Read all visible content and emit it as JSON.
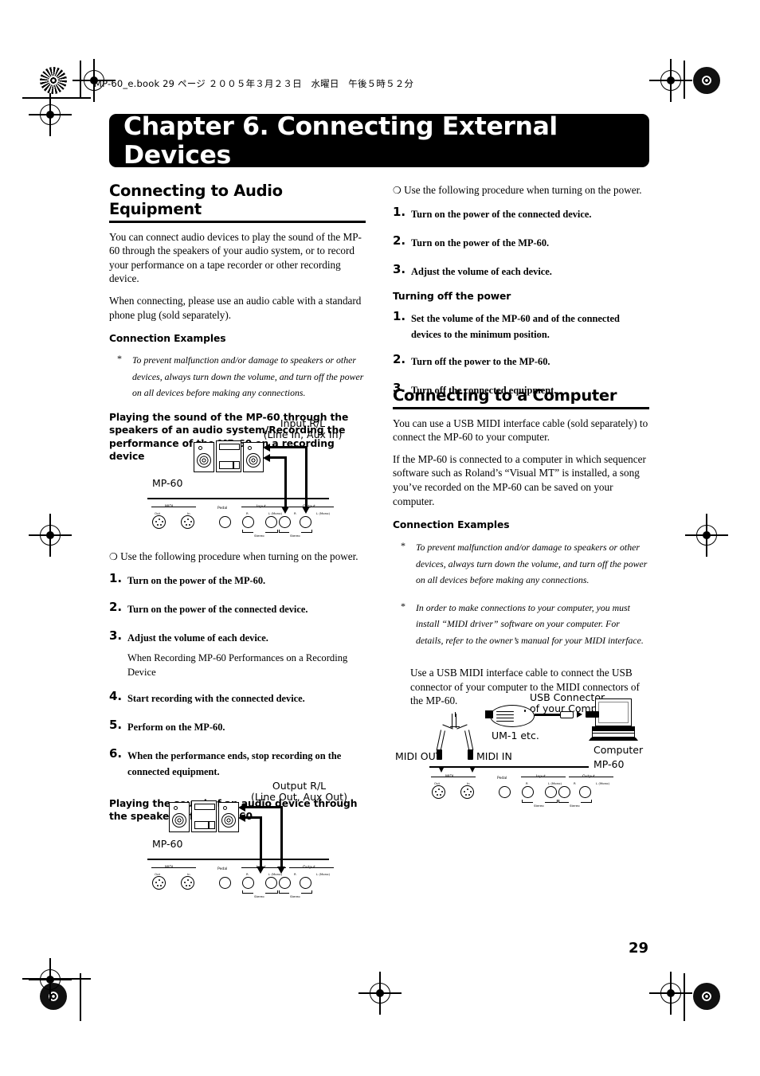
{
  "page": {
    "header_line": "MP-60_e.book  29 ページ  ２００５年３月２３日　水曜日　午後５時５２分",
    "chapter_title": "Chapter 6. Connecting External Devices",
    "page_number": "29"
  },
  "left_column": {
    "section_title": "Connecting to Audio Equipment",
    "paragraphs": [
      "You can connect audio devices to play the sound of the MP-60 through the speakers of your audio system, or to record your performance on a tape recorder or other recording device.",
      "When connecting, please use an audio cable with a standard phone plug (sold separately)."
    ],
    "connection_examples_heading": "Connection Examples",
    "note_star": "*",
    "note_text": "To prevent malfunction and/or damage to speakers or other devices, always turn down the volume, and turn off the power on all devices before making any connections.",
    "subheading_1": "Playing the sound of the MP-60 through the speakers of an audio system/Recording the performance of the MP-60 on a recording device",
    "power_on_line": "Use the following procedure when turning on the power.",
    "steps": [
      {
        "num": "1.",
        "text": "Turn on the power of the MP-60."
      },
      {
        "num": "2.",
        "text": "Turn on the power of the connected device."
      },
      {
        "num": "3.",
        "text": "Adjust the volume of each device.",
        "sub": "When Recording MP-60 Performances on a Recording Device"
      },
      {
        "num": "4.",
        "text": "Start recording with the connected device."
      },
      {
        "num": "5.",
        "text": "Perform on the MP-60."
      },
      {
        "num": "6.",
        "text": "When the performance ends, stop recording on the connected equipment."
      }
    ],
    "subheading_2": "Playing the sound of an audio device through the speakers of the MP-60"
  },
  "right_column": {
    "power_on_line": "Use the following procedure when turning on the power.",
    "power_on_steps": [
      {
        "num": "1.",
        "text": "Turn on the power of the connected device."
      },
      {
        "num": "2.",
        "text": "Turn on the power of the MP-60."
      },
      {
        "num": "3.",
        "text": "Adjust the volume of each device."
      }
    ],
    "power_off_heading": "Turning off the power",
    "power_off_steps": [
      {
        "num": "1.",
        "text": "Set the volume of the MP-60 and of the connected devices to the minimum position."
      },
      {
        "num": "2.",
        "text": "Turn off the power to the MP-60."
      },
      {
        "num": "3.",
        "text": "Turn off the connected equipment."
      }
    ],
    "section_title": "Connecting to a Computer",
    "paragraphs": [
      "You can use a USB MIDI interface cable (sold separately) to connect the MP-60 to your computer.",
      "If the MP-60 is connected to a computer in which sequencer software such as Roland’s “Visual MT” is installed, a song you’ve recorded on the MP-60 can be saved on your computer."
    ],
    "connection_examples_heading": "Connection Examples",
    "note_star": "*",
    "note_1": "To prevent malfunction and/or damage to speakers or other devices, always turn down the volume, and turn off the power on all devices before making any connections.",
    "note_2": "In order to make connections to your computer, you must install “MIDI driver” software on your computer. For details, refer to the owner’s manual for your MIDI interface.",
    "paragraph_after_notes": "Use a USB MIDI interface cable to connect the USB connector of your computer to the MIDI connectors of the MP-60."
  },
  "diagram_audio_out": {
    "callout": "Input R/L",
    "callout_sub": "(Line In, Aux In)",
    "device_label": "MP-60",
    "panel": {
      "midi_group": "MIDI",
      "midi_out": "Out",
      "midi_in": "In",
      "pedal": "Pedal",
      "input_group": "Input",
      "input_r": "R",
      "input_l": "L (Mono)",
      "output_group": "Output",
      "output_r": "R",
      "output_l": "L (Mono)",
      "stereo_left": "Stereo",
      "stereo_right": "Stereo"
    }
  },
  "diagram_audio_in": {
    "callout": "Output  R/L",
    "callout_sub": "(Line Out, Aux Out)",
    "device_label": "MP-60",
    "panel": {
      "midi_group": "MIDI",
      "midi_out": "Out",
      "midi_in": "In",
      "pedal": "Pedal",
      "input_group": "Input",
      "input_r": "R",
      "input_l": "L (Mono)",
      "output_group": "Output",
      "output_r": "R",
      "output_l": "L (Mono)",
      "stereo_left": "Stereo",
      "stereo_right": "Stereo"
    }
  },
  "diagram_computer": {
    "usb_callout": "USB Connector",
    "usb_callout_sub": "of your Computer",
    "interface_label": "UM-1 etc.",
    "computer_label": "Computer",
    "midi_out_label": "MIDI OUT",
    "midi_in_label": "MIDI IN",
    "device_label": "MP-60",
    "panel": {
      "midi_group": "MIDI",
      "midi_out": "Out",
      "midi_in": "In",
      "pedal": "Pedal",
      "input_group": "Input",
      "input_r": "R",
      "input_l": "L (Mono)",
      "output_group": "Output",
      "output_r": "R",
      "output_l": "L (Mono)",
      "stereo_left": "Stereo",
      "stereo_right": "Stereo"
    }
  }
}
